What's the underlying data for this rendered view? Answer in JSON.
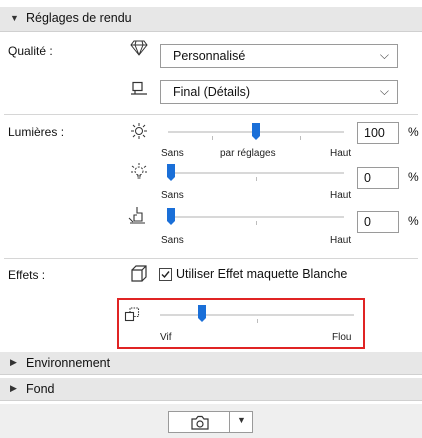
{
  "render_settings": {
    "title": "Réglages de rendu"
  },
  "quality": {
    "label": "Qualité :",
    "engine_select": "Personnalisé",
    "detail_select": "Final (Détails)"
  },
  "lights": {
    "label": "Lumières :",
    "sun": {
      "value": "100",
      "unit": "%",
      "slider_level": 0.5,
      "min_label": "Sans",
      "mid_label": "par réglages",
      "max_label": "Haut"
    },
    "lamp": {
      "value": "0",
      "unit": "%",
      "slider_level": 0.0,
      "min_label": "Sans",
      "max_label": "Haut"
    },
    "ambient": {
      "value": "0",
      "unit": "%",
      "slider_level": 0.0,
      "min_label": "Sans",
      "max_label": "Haut"
    }
  },
  "effects": {
    "label": "Effets :",
    "white_model_checkbox": {
      "label": "Utiliser Effet maquette Blanche",
      "checked": true
    },
    "blur": {
      "slider_level": 0.2,
      "min_label": "Vif",
      "max_label": "Flou"
    }
  },
  "sections": {
    "environment": "Environnement",
    "background": "Fond"
  },
  "colors": {
    "accent": "#1a6fd8",
    "highlight": "#e02424"
  }
}
